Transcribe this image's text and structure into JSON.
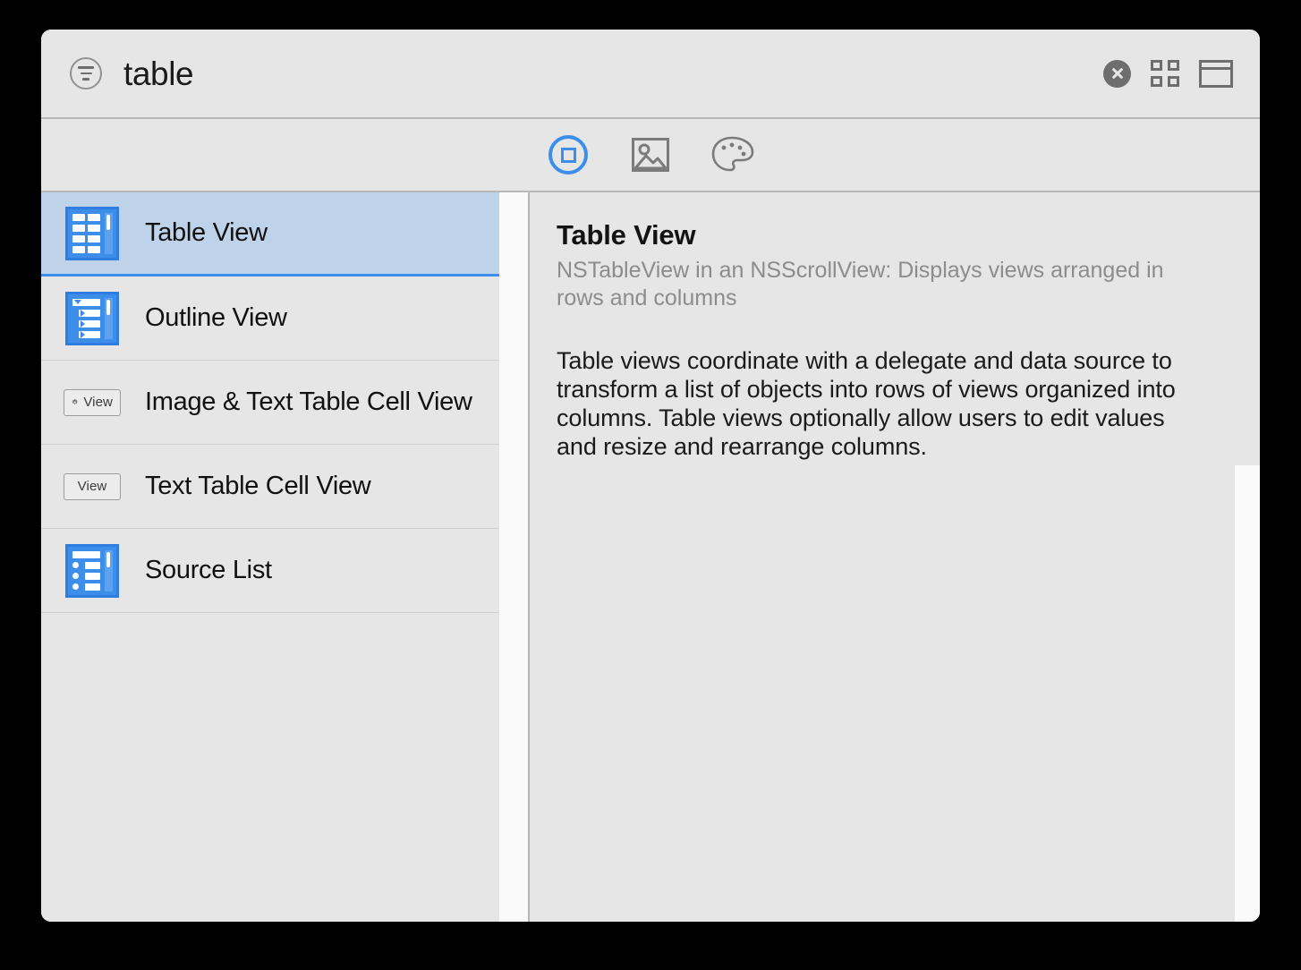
{
  "window": {
    "title": "table"
  },
  "search": {
    "icon": "filter-icon",
    "value": "table",
    "placeholder": "Filter"
  },
  "header_actions": [
    {
      "name": "clear-search-button",
      "icon": "close-circle-icon",
      "label": ""
    },
    {
      "name": "grid-view-button",
      "icon": "grid-icon",
      "label": ""
    },
    {
      "name": "list-view-button",
      "icon": "list-layout-icon",
      "label": ""
    }
  ],
  "tabs": [
    {
      "name": "tab-object-library",
      "icon": "object-library-icon",
      "label": "",
      "selected": true
    },
    {
      "name": "tab-media-library",
      "icon": "media-library-icon",
      "label": "",
      "selected": false
    },
    {
      "name": "tab-color-library",
      "icon": "color-palette-icon",
      "label": "",
      "selected": false
    }
  ],
  "colors": {
    "accent": "#3d8ee8",
    "selection_bg": "#bed3ea",
    "window_bg": "#e6e6e6",
    "icon_gray": "#6e6e6e",
    "subtitle_gray": "#8c8c8c"
  },
  "sidebar": {
    "items": [
      {
        "label": "Table View",
        "icon": "table-view-icon",
        "selected": true
      },
      {
        "label": "Outline View",
        "icon": "outline-view-icon",
        "selected": false
      },
      {
        "label": "Image & Text Table Cell View",
        "icon": "gear-view-badge",
        "badge": "View",
        "selected": false
      },
      {
        "label": "Text Table Cell View",
        "icon": "view-badge",
        "badge": "View",
        "selected": false
      },
      {
        "label": "Source List",
        "icon": "source-list-icon",
        "selected": false
      }
    ]
  },
  "detail": {
    "title": "Table View",
    "subtitle": "NSTableView in an NSScrollView: Displays views arranged in rows and columns",
    "body": "Table views coordinate with a delegate and data source to transform a list of objects into rows of views organized into columns. Table views optionally allow users to edit values and resize and rearrange columns."
  }
}
